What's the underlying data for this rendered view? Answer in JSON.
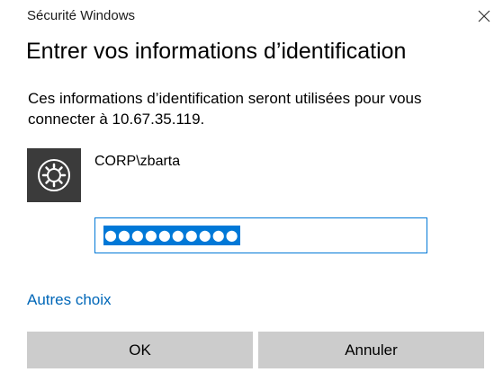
{
  "window": {
    "title": "Sécurité Windows"
  },
  "dialog": {
    "heading": "Entrer vos informations d’identification",
    "description": "Ces informations d’identification seront utilisées pour vous connecter à 10.67.35.119.",
    "credential": {
      "icon": "credential-gear-icon",
      "username": "CORP\\zbarta"
    },
    "password": {
      "masked_value": "●●●●●●●●●●",
      "selected": true
    },
    "other_choices_link": "Autres choix",
    "ok_button": "OK",
    "cancel_button": "Annuler"
  },
  "colors": {
    "accent": "#0078d7",
    "link": "#0067b8",
    "button_bg": "#cccccc",
    "tile_bg": "#3b3b3b"
  }
}
